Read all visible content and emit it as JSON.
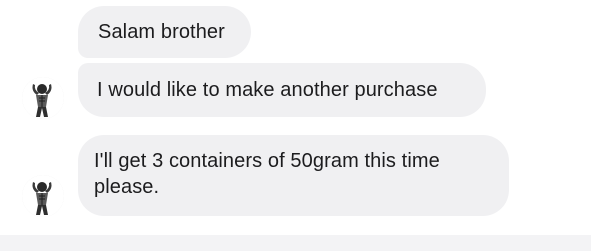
{
  "messages": [
    {
      "text": "Salam brother"
    },
    {
      "text": "I would like to make another purchase"
    },
    {
      "text": "I'll get 3 containers of 50gram this time please."
    }
  ],
  "avatar": {
    "icon": "bodybuilder-avatar-icon"
  },
  "colors": {
    "bubble": "#f0f0f2",
    "text": "#1c1c1e",
    "background": "#ffffff"
  }
}
